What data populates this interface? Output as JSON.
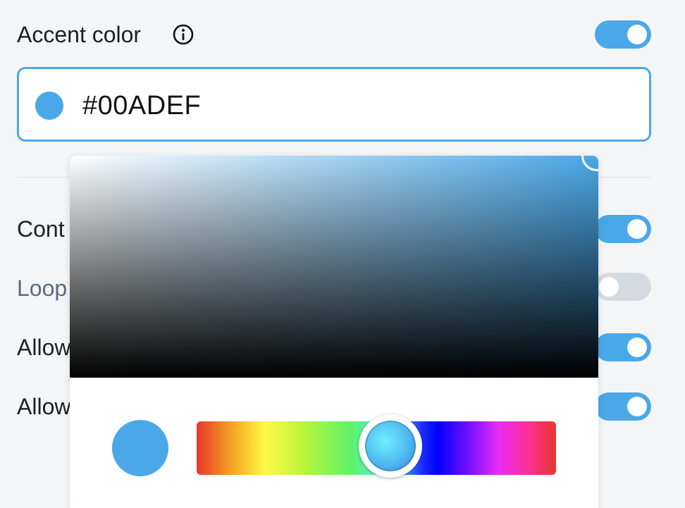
{
  "accent": {
    "label": "Accent color",
    "info_icon": "info-circle-icon",
    "toggle_on": true,
    "value": "#00ADEF",
    "swatch_color": "#4aa8e8"
  },
  "settings": [
    {
      "label": "Cont",
      "toggle_on": true
    },
    {
      "label": "Loop",
      "toggle_on": false,
      "muted": true
    },
    {
      "label": "Allow",
      "toggle_on": true
    },
    {
      "label": "Allow",
      "toggle_on": true
    }
  ],
  "picker": {
    "hue_color": "#4aa8e8",
    "preview_color": "#4aa8e8"
  },
  "colors": {
    "accent": "#4aa8e8",
    "toggle_off": "#d5dae0",
    "muted_text": "#5b6b80"
  }
}
